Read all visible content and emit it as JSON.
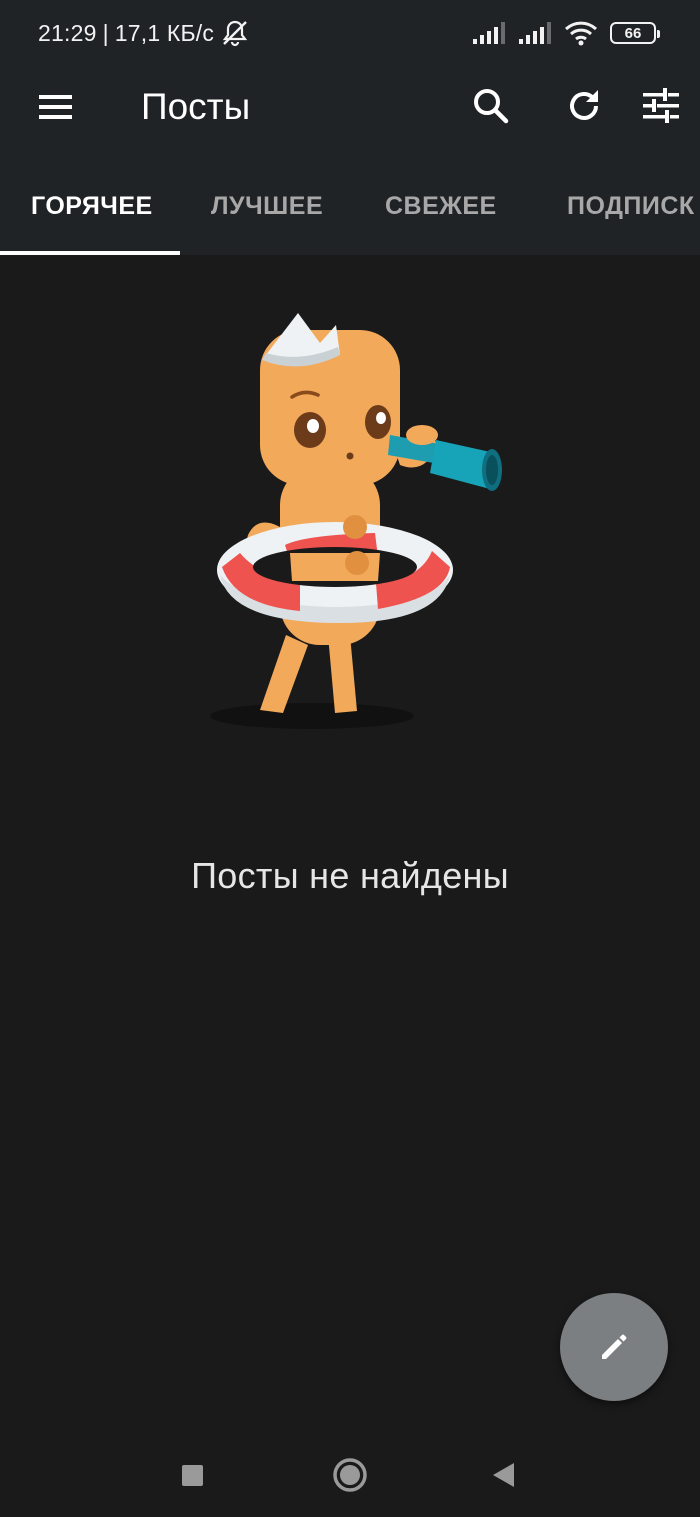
{
  "status_bar": {
    "time": "21:29",
    "separator": "|",
    "speed": "17,1 КБ/с",
    "battery": "66",
    "icons": [
      "mute-bell-icon",
      "signal-icon",
      "signal-icon",
      "wifi-icon",
      "battery-icon"
    ]
  },
  "app_bar": {
    "title": "Посты",
    "icons": [
      "menu-icon",
      "search-icon",
      "refresh-icon",
      "filter-sliders-icon"
    ]
  },
  "tabs": [
    {
      "label": "ГОРЯЧЕЕ",
      "active": true
    },
    {
      "label": "ЛУЧШЕЕ",
      "active": false
    },
    {
      "label": "СВЕЖЕЕ",
      "active": false
    },
    {
      "label": "ПОДПИСК",
      "active": false
    }
  ],
  "empty_state": {
    "message": "Посты не найдены",
    "illustration": "gingerbread-sailor-with-telescope"
  },
  "fab": {
    "icon": "pencil-icon"
  },
  "nav_bar": {
    "icons": [
      "square-recents-icon",
      "circle-home-icon",
      "triangle-back-icon"
    ]
  },
  "colors": {
    "background": "#1a1a1a",
    "appbar": "#202325",
    "fab": "#7b7f82",
    "tab_active": "#ffffff",
    "tab_inactive": "#a8a8a8"
  }
}
